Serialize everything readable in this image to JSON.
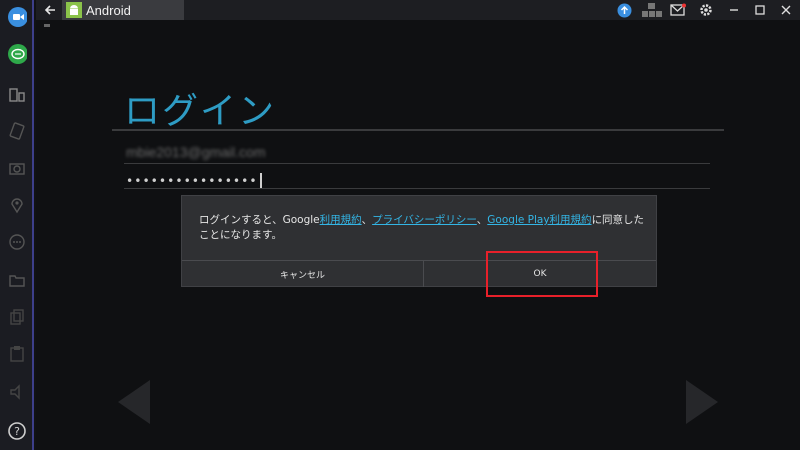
{
  "window": {
    "tab_title": "Android",
    "tab_icon": "android-icon"
  },
  "toolbar_icons": [
    "back-arrow-icon",
    "upload-icon",
    "keyboard-icon",
    "mail-icon",
    "gear-icon",
    "minimize-icon",
    "maximize-icon",
    "close-icon"
  ],
  "sidebar_icons": [
    "video-camera-icon",
    "chat-icon",
    "multi-window-icon",
    "rotate-icon",
    "camera-icon",
    "location-icon",
    "more-icon",
    "folder-icon",
    "copy-icon",
    "paste-icon",
    "volume-icon",
    "help-icon"
  ],
  "login": {
    "title": "ログイン",
    "email_value": "mbie2013@gmail.com",
    "password_value": "••••••••••••••••"
  },
  "dialog": {
    "message_prefix": "ログインすると、Google",
    "link_terms": "利用規約",
    "sep1": "、",
    "link_privacy": "プライバシーポリシー",
    "sep2": "、",
    "link_play_terms": "Google Play利用規約",
    "message_suffix": "に同意したことになります。",
    "cancel_label": "キャンセル",
    "ok_label": "OK"
  },
  "colors": {
    "accent": "#2e9cc4",
    "link": "#33b5e5",
    "highlight": "#e8202a"
  }
}
